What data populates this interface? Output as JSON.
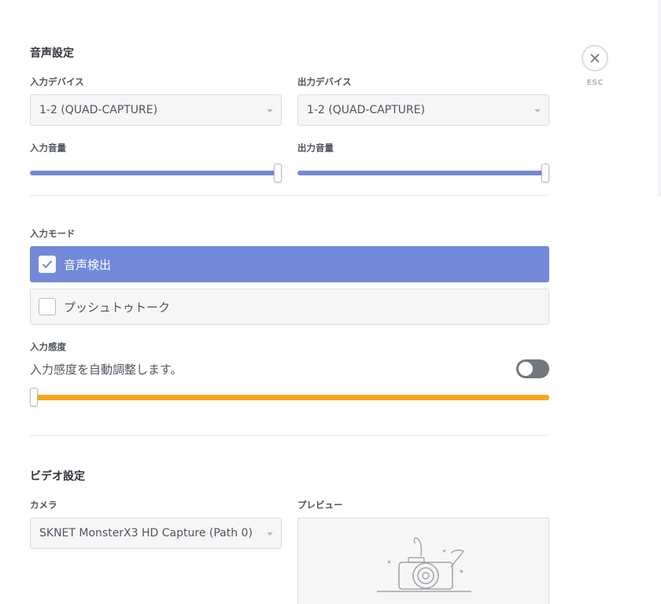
{
  "close": {
    "icon": "close-icon",
    "label": "ESC"
  },
  "voice": {
    "title": "音声設定",
    "input_device": {
      "label": "入力デバイス",
      "value": "1-2 (QUAD-CAPTURE)"
    },
    "output_device": {
      "label": "出力デバイス",
      "value": "1-2 (QUAD-CAPTURE)"
    },
    "input_volume": {
      "label": "入力音量",
      "level": 1.0
    },
    "output_volume": {
      "label": "出力音量",
      "level": 1.0
    },
    "input_mode": {
      "label": "入力モード",
      "options": [
        {
          "label": "音声検出",
          "selected": true
        },
        {
          "label": "プッシュトゥトーク",
          "selected": false
        }
      ]
    },
    "sensitivity": {
      "label": "入力感度",
      "auto_text": "入力感度を自動調整します。",
      "auto_enabled": false,
      "level": 0.0
    }
  },
  "video": {
    "title": "ビデオ設定",
    "camera": {
      "label": "カメラ",
      "value": "SKNET MonsterX3 HD Capture (Path 0)"
    },
    "preview": {
      "label": "プレビュー"
    }
  },
  "colors": {
    "accent": "#7289da",
    "sensitivity_bar": "#faa61a",
    "toggle_off": "#72767d"
  }
}
